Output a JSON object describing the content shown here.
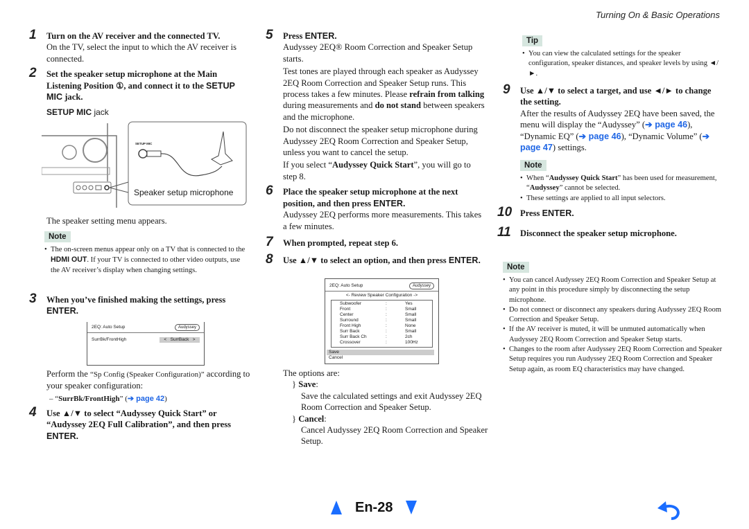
{
  "header": {
    "section": "Turning On & Basic Operations"
  },
  "steps": {
    "s1": {
      "num": "1",
      "title": "Turn on the AV receiver and the connected TV.",
      "body": "On the TV, select the input to which the AV receiver is connected."
    },
    "s2": {
      "num": "2",
      "title_a": "Set the speaker setup microphone at the Main Listening Position ①, and connect it to the ",
      "title_b": "SETUP MIC",
      "title_c": " jack."
    },
    "s3": {
      "num": "3",
      "title_a": "When you’ve finished making the settings, press ",
      "title_b": "ENTER."
    },
    "s4": {
      "num": "4",
      "title_a": "Use ▲/▼ to select “Audyssey Quick Start” or “Audyssey 2EQ Full Calibration”, and then press ",
      "title_b": "ENTER."
    },
    "s5": {
      "num": "5",
      "title_a": "Press ",
      "title_b": "ENTER.",
      "p1": "Audyssey 2EQ® Room Correction and Speaker Setup starts.",
      "p2_a": "Test tones are played through each speaker as Audyssey 2EQ Room Correction and Speaker Setup runs. This process takes a few minutes. Please ",
      "p2_b": "refrain from talking",
      "p2_c": " during measurements and ",
      "p2_d": "do not stand",
      "p2_e": " between speakers and the microphone.",
      "p3": "Do not disconnect the speaker setup microphone during Audyssey 2EQ Room Correction and Speaker Setup, unless you want to cancel the setup.",
      "p4_a": "If you select “",
      "p4_b": "Audyssey Quick Start",
      "p4_c": "”, you will go to step 8."
    },
    "s6": {
      "num": "6",
      "title_a": "Place the speaker setup microphone at the next position, and then press ",
      "title_b": "ENTER.",
      "body": "Audyssey 2EQ performs more measurements. This takes a few minutes."
    },
    "s7": {
      "num": "7",
      "title": "When prompted, repeat step 6."
    },
    "s8": {
      "num": "8",
      "title_a": "Use ▲/▼ to select an option, and then press ",
      "title_b": "ENTER."
    },
    "s9": {
      "num": "9",
      "title": "Use ▲/▼ to select a target, and use ◄/► to change the setting.",
      "b_a": "After the results of Audyssey 2EQ have been saved, the menu will display the “Audyssey” (",
      "link1": "➔ page 46",
      "b_b": "), “Dynamic EQ” (",
      "link2": "➔ page 46",
      "b_c": "), “Dynamic Volume” (",
      "link3": "➔ page 47",
      "b_d": ") settings."
    },
    "s10": {
      "num": "10",
      "title_a": "Press ",
      "title_b": "ENTER."
    },
    "s11": {
      "num": "11",
      "title": "Disconnect the speaker setup microphone."
    }
  },
  "figure": {
    "caption_a": "SETUP MIC",
    "caption_b": " jack",
    "jack_label": "SETUP MIC",
    "mic_label": "Speaker setup microphone"
  },
  "menu_appears": "The speaker setting menu appears.",
  "note1": {
    "label": "Note",
    "text_a": "The on-screen menus appear only on a TV that is connected to the ",
    "text_b": "HDMI OUT",
    "text_c": ". If your TV is connected to other video outputs, use the AV receiver’s display when changing settings."
  },
  "osd1": {
    "title": "2EQ: Auto Setup",
    "badge": "Audyssey",
    "row_label": "SurrBk/FrontHigh",
    "row_value": "<   SurrBack   >"
  },
  "perform": {
    "a": "Perform the ",
    "b": "“Sp Config (Speaker Configuration)”",
    "c": " according to your speaker configuration:",
    "item_a": "– “",
    "item_b": "SurrBk/FrontHigh",
    "item_c": "” (",
    "item_link": "➔ page 42",
    "item_d": ")"
  },
  "osd2": {
    "title": "2EQ: Auto Setup",
    "badge": "Audyssey",
    "subtitle": "<- Review Speaker Configuration ->",
    "rows": [
      {
        "label": "Subwoofer",
        "sep": ":",
        "value": "Yes"
      },
      {
        "label": "Front",
        "sep": ":",
        "value": "Small"
      },
      {
        "label": "Center",
        "sep": ":",
        "value": "Small"
      },
      {
        "label": "Surround",
        "sep": ":",
        "value": "Small"
      },
      {
        "label": "Front High",
        "sep": ":",
        "value": "None"
      },
      {
        "label": "Surr Back",
        "sep": ":",
        "value": "Small"
      },
      {
        "label": "Surr Back Ch",
        "sep": ":",
        "value": "2ch"
      },
      {
        "label": "Crossover",
        "sep": ":",
        "value": "100Hz"
      }
    ],
    "save": "Save",
    "cancel": "Cancel"
  },
  "options": {
    "intro": "The options are:",
    "save_label": "Save",
    "save_desc": "Save the calculated settings and exit Audyssey 2EQ Room Correction and Speaker Setup.",
    "cancel_label": "Cancel",
    "cancel_desc": "Cancel Audyssey 2EQ Room Correction and Speaker Setup.",
    "bullet": "}"
  },
  "tip": {
    "label": "Tip",
    "text": "You can view the calculated settings for the speaker configuration, speaker distances, and speaker levels by using ◄/►."
  },
  "note2": {
    "label": "Note",
    "i1_a": "When “",
    "i1_b": "Audyssey Quick Start",
    "i1_c": "” has been used for measurement, “",
    "i1_d": "Audyssey",
    "i1_e": "” cannot be selected.",
    "i2": "These settings are applied to all input selectors."
  },
  "note3": {
    "label": "Note",
    "items": [
      "You can cancel Audyssey 2EQ Room Correction and Speaker Setup at any point in this procedure simply by disconnecting the setup microphone.",
      "Do not connect or disconnect any speakers during Audyssey 2EQ Room Correction and Speaker Setup.",
      "If the AV receiver is muted, it will be unmuted automatically when Audyssey 2EQ Room Correction and Speaker Setup starts.",
      "Changes to the room after Audyssey 2EQ Room Correction and Speaker Setup requires you run Audyssey 2EQ Room Correction and Speaker Setup again, as room EQ characteristics may have changed."
    ]
  },
  "footer": {
    "page": "En-28",
    "accent": "#1a6dff"
  }
}
